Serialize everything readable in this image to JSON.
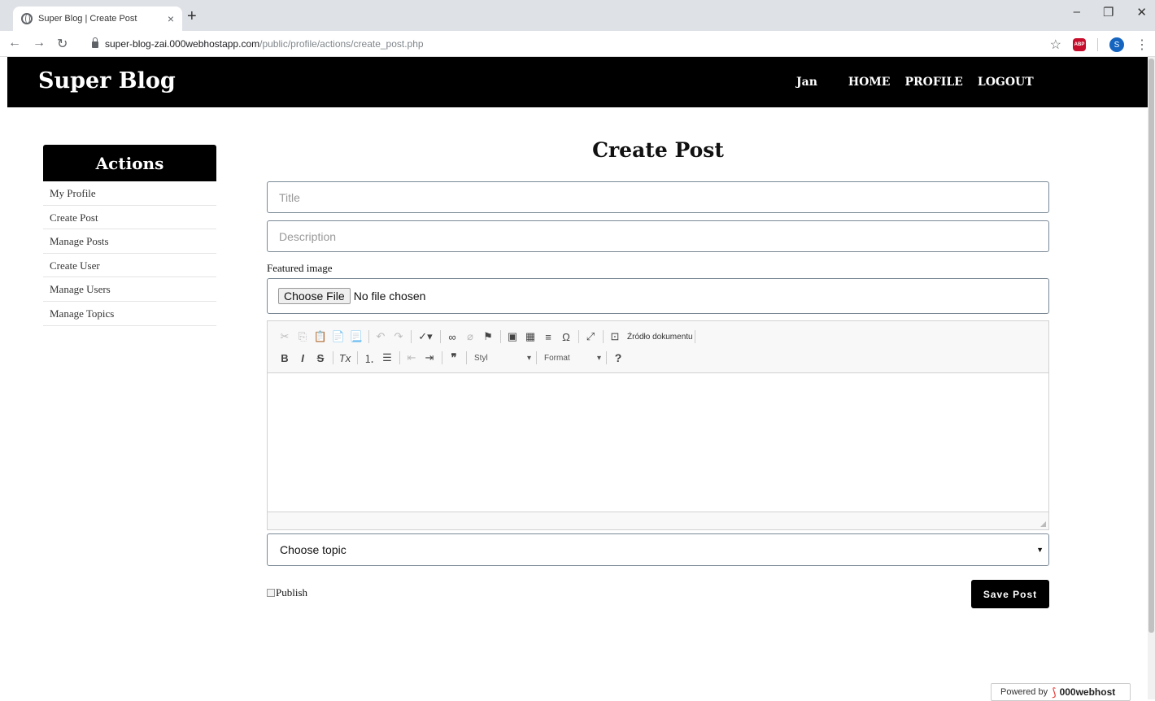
{
  "browser": {
    "tab_title": "Super Blog | Create Post",
    "tab_close": "×",
    "new_tab": "+",
    "url_host": "super-blog-zai.000webhostapp.com",
    "url_path": "/public/profile/actions/create_post.php",
    "abp_label": "ABP",
    "profile_initial": "S"
  },
  "header": {
    "logo": "Super Blog",
    "user": "Jan",
    "nav": [
      "HOME",
      "PROFILE",
      "LOGOUT"
    ]
  },
  "sidebar": {
    "title": "Actions",
    "items": [
      "My Profile",
      "Create Post",
      "Manage Posts",
      "Create User",
      "Manage Users",
      "Manage Topics"
    ]
  },
  "form": {
    "page_title": "Create Post",
    "title_placeholder": "Title",
    "description_placeholder": "Description",
    "featured_image_label": "Featured image",
    "choose_file_label": "Choose File",
    "no_file_text": "No file chosen",
    "topic_placeholder": "Choose topic",
    "publish_label": "Publish",
    "save_label": "Save Post"
  },
  "editor": {
    "source_label": "Źródło dokumentu",
    "style_label": "Styl",
    "format_label": "Format",
    "help_label": "?"
  },
  "footer": {
    "powered_by": "Powered by",
    "brand": "000webhost"
  }
}
